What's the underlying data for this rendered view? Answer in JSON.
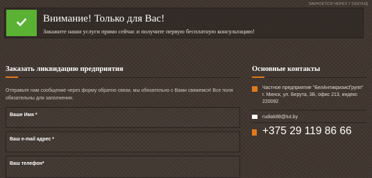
{
  "popup": {
    "close_timer": "ЗАКРОЕТСЯ ЧЕРЕЗ 7 СЕКУНД",
    "title": "Внимание! Только для Вас!",
    "text": "Закажите наши услуги прямо сейчас и получите первую бесплатную консультацию!",
    "icon": "check-icon"
  },
  "order": {
    "heading": "Заказать ликвидацию предприятия",
    "intro": "Отправьте нам сообщение через форму обратно связи, мы обязательно с Вами свяжемся! Все поля обязательны для заполнения.",
    "fields": [
      {
        "label": "Ваше Имя *"
      },
      {
        "label": "Ваш e-mail адрес *"
      },
      {
        "label": "Ваш телефон*"
      }
    ]
  },
  "contacts": {
    "heading": "Основные контакты",
    "address": "Частное предприятие \"БелАнтикризисГрупп\" г. Минск, ул. Берута, 3Б, офис 213, индекс 220092",
    "email": "rudiak88@tut.by",
    "phone": "+375 29 119 86 66"
  },
  "colors": {
    "accent": "#e07a1c",
    "success": "#5ab133",
    "background": "#40352f"
  }
}
